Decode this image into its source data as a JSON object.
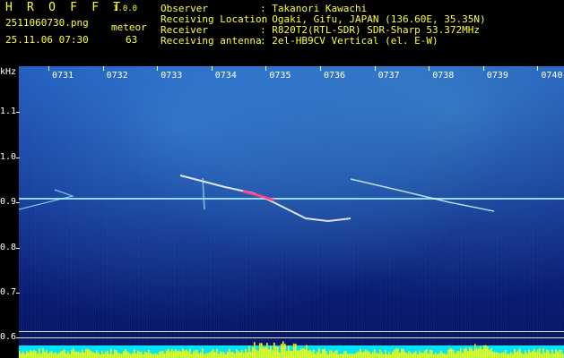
{
  "header": {
    "app_title": "H R O F F T",
    "app_version": "1.0.0",
    "file_name": "2511060730.png",
    "datetime": "25.11.06 07:30",
    "meteor_label": "meteor",
    "meteor_count": "63",
    "info": [
      {
        "key": "Observer",
        "value": ": Takanori Kawachi"
      },
      {
        "key": "Receiving Location",
        "value": ": Ogaki, Gifu, JAPAN (136.60E, 35.35N)"
      },
      {
        "key": "Receiver",
        "value": ": R820T2(RTL-SDR) SDR-Sharp 53.372MHz"
      },
      {
        "key": "Receiving antenna",
        "value": ": 2el-HB9CV Vertical (el. E-W)"
      }
    ]
  },
  "spectrogram": {
    "y_unit": "kHz",
    "y_ticks": [
      "1.1",
      "1.0",
      "0.9",
      "0.8",
      "0.7",
      "0.6"
    ],
    "time_ticks": [
      "0731",
      "0732",
      "0733",
      "0734",
      "0735",
      "0736",
      "0737",
      "0738",
      "0739",
      "0740"
    ],
    "colors": {
      "label": "#ffff33",
      "level": "#00e5ff",
      "bars": "#ffff00",
      "carrier": "#9fe8ff"
    }
  }
}
